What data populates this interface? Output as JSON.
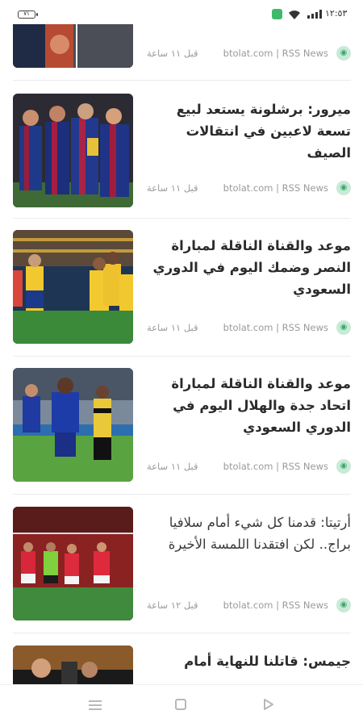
{
  "status_bar": {
    "time": "١٢:٥٣",
    "battery": "٧١"
  },
  "feed": {
    "items": [
      {
        "title": "",
        "source": "btolat.com | RSS News",
        "time": "قبل ١١ ساعة",
        "icon": "rss-icon"
      },
      {
        "title": "ميرور: برشلونة يستعد لبيع تسعة لاعبين في انتقالات الصيف",
        "source": "btolat.com | RSS News",
        "time": "قبل ١١ ساعة",
        "icon": "rss-icon"
      },
      {
        "title": "موعد والقناة الناقلة لمباراة النصر وضمك اليوم في الدوري السعودي",
        "source": "btolat.com | RSS News",
        "time": "قبل ١١ ساعة",
        "icon": "rss-icon"
      },
      {
        "title": "موعد والقناة الناقلة لمباراة اتحاد جدة والهلال اليوم في الدوري السعودي",
        "source": "btolat.com | RSS News",
        "time": "قبل ١١ ساعة",
        "icon": "rss-icon"
      },
      {
        "title": "أرتيتا: قدمنا كل شيء أمام سلافيا براج.. لكن افتقدنا اللمسة الأخيرة",
        "source": "btolat.com | RSS News",
        "time": "قبل ١٢ ساعة",
        "icon": "rss-icon"
      },
      {
        "title": "جيمس: قاتلنا للنهاية أمام",
        "source": "",
        "time": "",
        "icon": "rss-icon"
      }
    ]
  },
  "nav_bar": {
    "icons": [
      "menu-icon",
      "home-icon",
      "back-icon"
    ]
  },
  "colors": {
    "rss_badge_bg": "#c8ead7",
    "rss_badge_fg": "#3ea86b",
    "title_text": "#2b2b2b",
    "meta_text": "#9a9a9a"
  }
}
